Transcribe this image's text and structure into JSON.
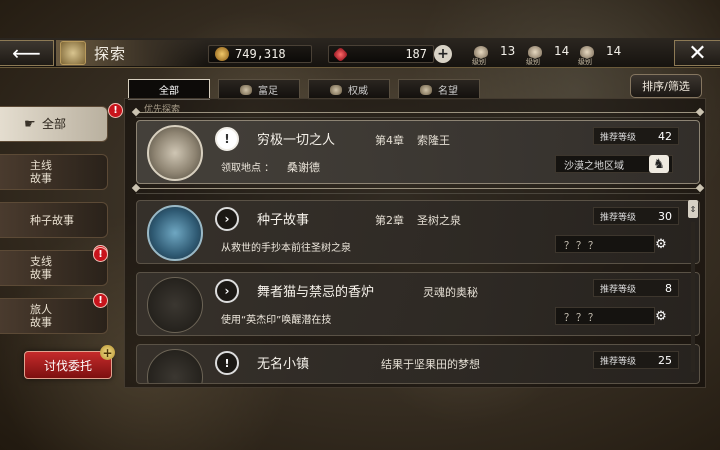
{
  "header": {
    "back_icon": "arrow-left-icon",
    "title": "探索",
    "gold": "749,318",
    "gems": "187",
    "level_tag": "级别",
    "levels": [
      "13",
      "14",
      "14"
    ],
    "close_icon": "close-icon"
  },
  "tabs": [
    {
      "label": "全部",
      "active": true
    },
    {
      "label": "富足",
      "icon": "wealth-emblem-icon"
    },
    {
      "label": "权威",
      "icon": "authority-emblem-icon"
    },
    {
      "label": "名望",
      "icon": "fame-emblem-icon"
    }
  ],
  "sort_button": "排序/筛选",
  "section_label": "优先探索",
  "nav": [
    {
      "label": "全部",
      "active": true,
      "badge": "!"
    },
    {
      "label": "主线\n故事"
    },
    {
      "label": "种子故事",
      "badge": "!"
    },
    {
      "label": "支线\n故事",
      "badge": "!"
    },
    {
      "label": "旅人\n故事",
      "badge": "!"
    }
  ],
  "request_button": "讨伐委托",
  "rec_label": "推荐等级",
  "quests": [
    {
      "title": "穷极一切之人",
      "chapter": "第4章",
      "chapter_name": "索隆王",
      "loc_label": "领取地点 ：",
      "loc_value": "桑谢德",
      "level": "42",
      "region": "沙漠之地区域"
    },
    {
      "title": "种子故事",
      "chapter": "第2章",
      "chapter_name": "圣树之泉",
      "desc": "从救世的手抄本前往圣树之泉",
      "level": "30",
      "unknown": "？？？"
    },
    {
      "title": "舞者猫与禁忌的香炉",
      "chapter_name": "灵魂的奥秘",
      "desc": "使用“英杰印”唤醒潜在技",
      "level": "8",
      "unknown": "？？？"
    },
    {
      "title": "无名小镇",
      "chapter_name": "结果于坚果田的梦想",
      "level": "25"
    }
  ],
  "colors": {
    "badge": "#c8141c",
    "request_btn": "#a31c1c",
    "accent_gold": "#b89a5c"
  }
}
